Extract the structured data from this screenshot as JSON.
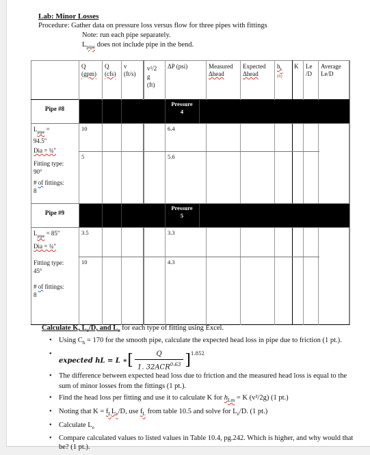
{
  "document": {
    "title": "Lab: Minor Losses",
    "procedure": "Procedure: Gather data on pressure loss versus flow for three pipes with fittings",
    "note1": "Note: run each pipe separately.",
    "note2_L": "L",
    "note2_sub": "pipe",
    "note2_rest": " does not include pipe in the bend."
  },
  "table": {
    "headers": {
      "q_gpm": [
        "Q",
        "(gpm)"
      ],
      "q_cfs": [
        "Q",
        "(cfs)"
      ],
      "v": [
        "v",
        "(ft/s)"
      ],
      "v2g": [
        "v²/2",
        "g",
        "(ft)"
      ],
      "dp": "ΔP (psi)",
      "measured": [
        "Measured",
        "Δhead"
      ],
      "expected": [
        "Expected",
        "Δhead"
      ],
      "hl": [
        "h",
        "L",
        "(ft)"
      ],
      "k": "K",
      "led": [
        "Le",
        "/D"
      ],
      "avg": [
        "Average",
        "Le/D"
      ]
    },
    "pipes": [
      {
        "name": "Pipe #8",
        "pressure_label": "Pressure",
        "pressure_value": "4",
        "L_label": "L",
        "L_sub": "pipe",
        "L_value": " = ",
        "L_value2": "94.5\"",
        "dia": "Dia = ¾\"",
        "fitting_label": "Fitting type:",
        "fitting_value": "90°",
        "count_label_a": "# ",
        "count_label_of": "of",
        "count_label_b": " fittings:",
        "count_value": "8",
        "rows": [
          {
            "q_gpm": "10",
            "dp": "6.4"
          },
          {
            "q_gpm": "5",
            "dp": "5.6"
          }
        ]
      },
      {
        "name": "Pipe #9",
        "pressure_label": "Pressure",
        "pressure_value": "5",
        "L_label": "L",
        "L_sub": "pipe",
        "L_value": " = 85\"",
        "dia": "Dia = ¾\"",
        "fitting_label": "Fitting type:",
        "fitting_value": "45°",
        "count_label_a": "# ",
        "count_label_of": "of",
        "count_label_b": " fittings:",
        "count_value": "8",
        "rows": [
          {
            "q_gpm": "3.5",
            "dp": "3.3"
          },
          {
            "q_gpm": "10",
            "dp": "4.3"
          }
        ]
      }
    ]
  },
  "calc": {
    "heading_underlined": "Calculate K, L",
    "heading_sub1": "e",
    "heading_mid": "/D, and L",
    "heading_sub2": "e",
    "heading_rest": " for each type of fitting using Excel.",
    "bullets": {
      "b1_a": "Using C",
      "b1_sub": "h",
      "b1_b": " = 170 for the smooth pipe, calculate the expected head loss in pipe due to friction (1 pt.).",
      "formula_left": "expected hL = L ∗",
      "formula_num": "Q",
      "formula_den": "1. 32ACR",
      "formula_den_exp": "0.63",
      "formula_exp": "1.852",
      "b3": "The difference between expected head loss due to friction and the measured head loss is equal to the sum of minor losses from the fittings (1 pt.).",
      "b4_a": "Find the head loss per fitting and use it to calculate K for ",
      "b4_h": "h",
      "b4_sub": "Lm",
      "b4_b": " = K (v²/2g) (1 pt.)",
      "b5_a": "Noting that K = ",
      "b5_f": "f",
      "b5_fsub": "L",
      "b5_L": "L",
      "b5_Lsub": "e",
      "b5_b": "/D, use ",
      "b5_f2": "f",
      "b5_f2sub": "L",
      "b5_c": " from table 10.5 and solve for L",
      "b5_csub": "e",
      "b5_d": "/D. (1 pt.)",
      "b6_a": "Calculate L",
      "b6_sub": "e",
      "b7": "Compare calculated values to listed values in Table 10.4, pg.242. Which is higher, and why would that be? (1 pt.)."
    }
  }
}
